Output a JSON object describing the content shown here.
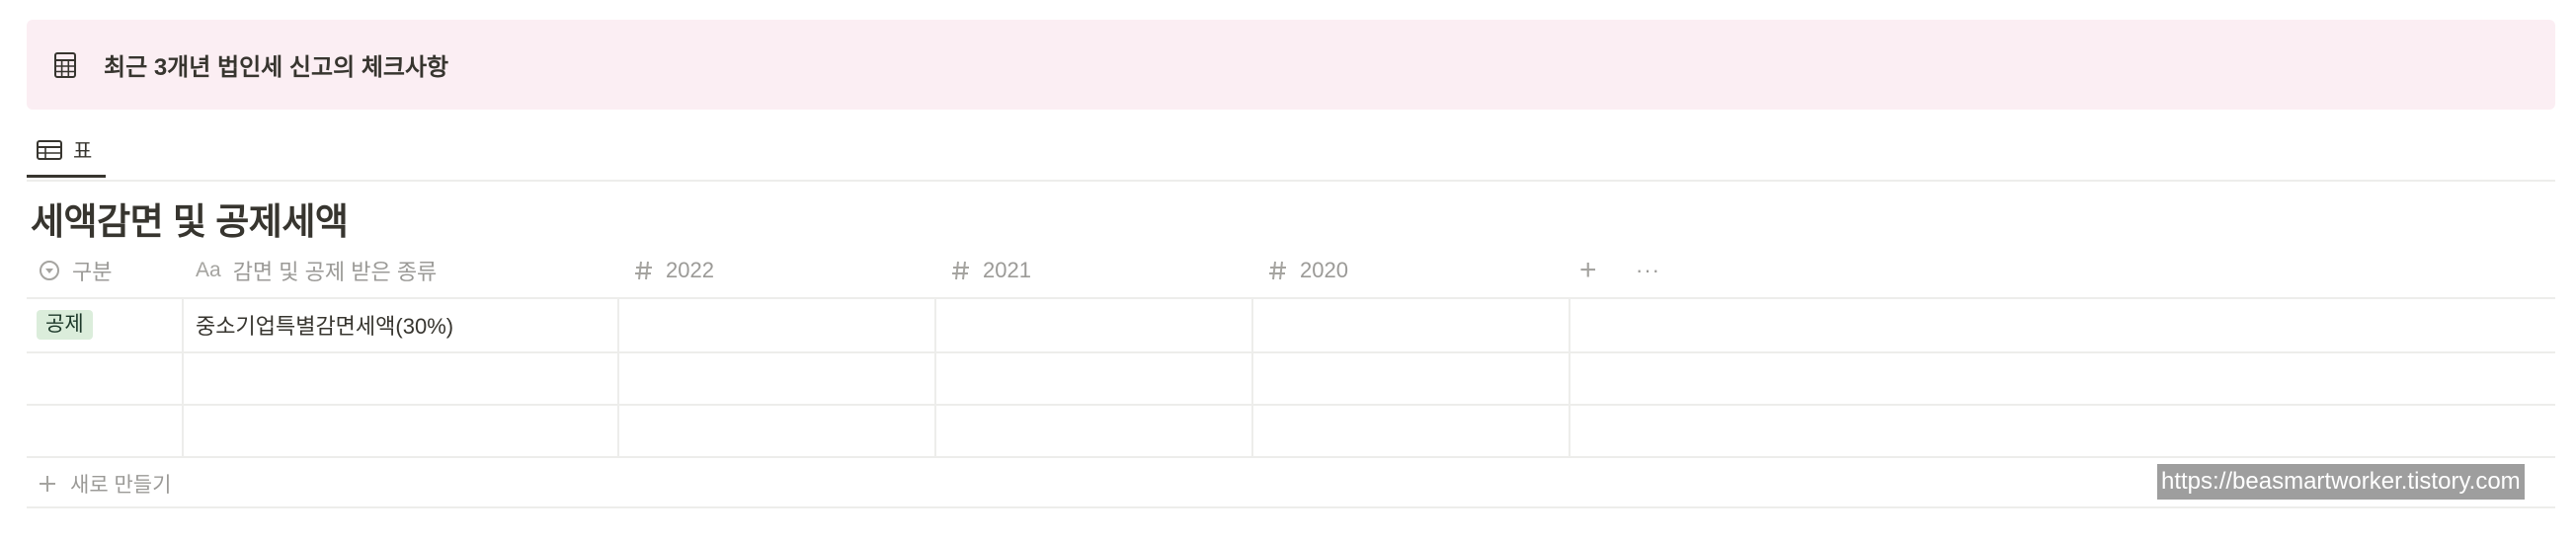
{
  "callout": {
    "icon": "calculator-icon",
    "text": "최근 3개년 법인세 신고의 체크사항",
    "background": "#fbeef3"
  },
  "view": {
    "tab_icon": "table-icon",
    "tab_label": "표"
  },
  "database": {
    "title": "세액감면 및 공제세액",
    "columns": [
      {
        "icon": "select-icon",
        "label": "구분"
      },
      {
        "icon": "title-icon",
        "icon_text": "Aa",
        "label": "감면 및 공제 받은 종류"
      },
      {
        "icon": "number-icon",
        "label": "2022"
      },
      {
        "icon": "number-icon",
        "label": "2021"
      },
      {
        "icon": "number-icon",
        "label": "2020"
      }
    ],
    "add_column": "+",
    "more": "···",
    "rows": [
      {
        "category": "공제",
        "category_color": "#dbeddb",
        "name": "중소기업특별감면세액(30%)",
        "y2022": "",
        "y2021": "",
        "y2020": ""
      },
      {
        "category": "",
        "name": "",
        "y2022": "",
        "y2021": "",
        "y2020": ""
      },
      {
        "category": "",
        "name": "",
        "y2022": "",
        "y2021": "",
        "y2020": ""
      }
    ],
    "new_row_label": "새로 만들기"
  },
  "watermark": "https://beasmartworker.tistory.com"
}
